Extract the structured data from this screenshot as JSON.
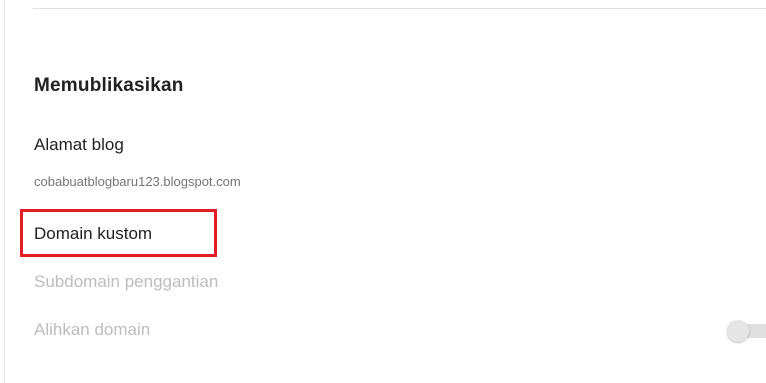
{
  "section": {
    "title": "Memublikasikan"
  },
  "blog_address": {
    "label": "Alamat blog",
    "value": "cobabuatblogbaru123.blogspot.com"
  },
  "custom_domain": {
    "label": "Domain kustom",
    "highlight_color": "#e31e24"
  },
  "fallback_subdomain": {
    "label": "Subdomain penggantian",
    "disabled": true
  },
  "redirect_domain": {
    "label": "Alihkan domain",
    "disabled": true,
    "toggle_on": false
  },
  "colors": {
    "text_primary": "#212121",
    "text_secondary": "#757575",
    "text_disabled": "#bdbdbd"
  }
}
